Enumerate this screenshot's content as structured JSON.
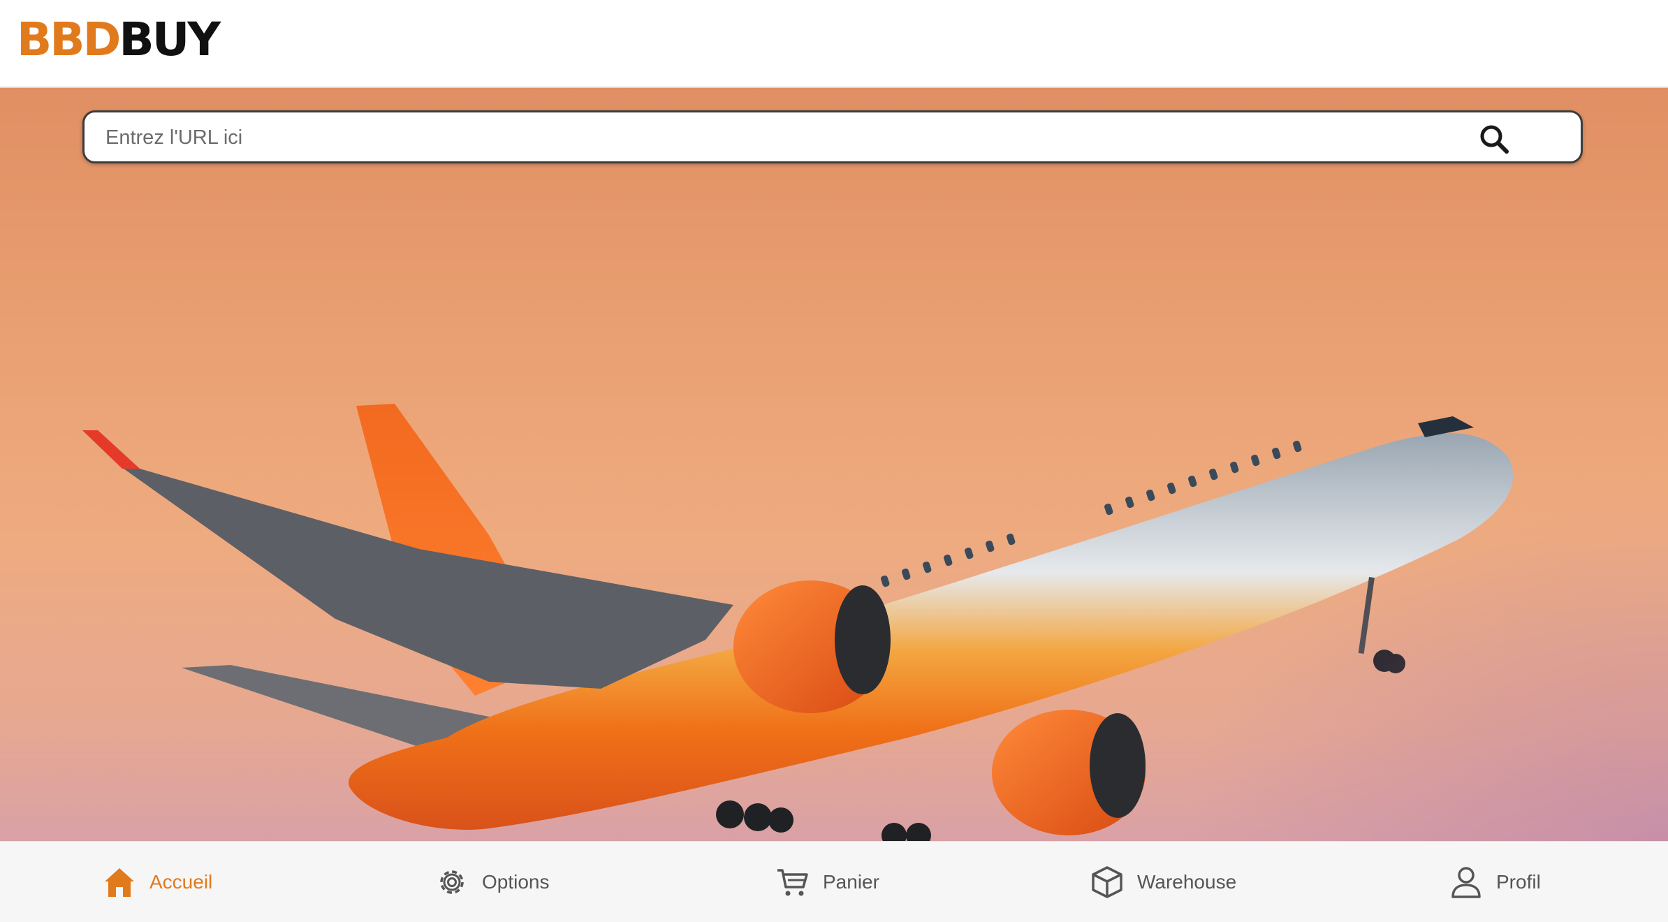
{
  "header": {
    "logo_part1": "BBD",
    "logo_part2": "BUY"
  },
  "search": {
    "placeholder": "Entrez l'URL ici",
    "icon": "search-icon"
  },
  "hero": {
    "image": "orange-and-silver-airliner-taking-off"
  },
  "bottom_nav": {
    "items": [
      {
        "label": "Accueil",
        "icon": "home-icon",
        "active": true
      },
      {
        "label": "Options",
        "icon": "gear-icon",
        "active": false
      },
      {
        "label": "Panier",
        "icon": "cart-icon",
        "active": false
      },
      {
        "label": "Warehouse",
        "icon": "box-icon",
        "active": false
      },
      {
        "label": "Profil",
        "icon": "user-icon",
        "active": false
      }
    ]
  },
  "colors": {
    "accent": "#e17a1c",
    "text_muted": "#555555"
  }
}
